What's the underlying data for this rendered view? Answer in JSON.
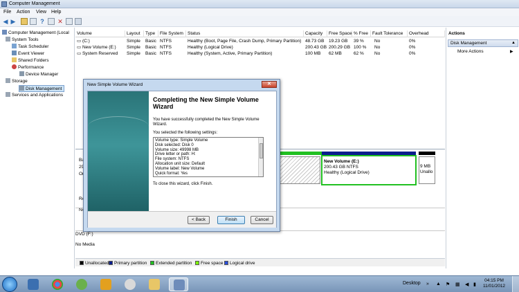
{
  "window": {
    "title": "Computer Management"
  },
  "menu": [
    "File",
    "Action",
    "View",
    "Help"
  ],
  "tree": {
    "root": "Computer Management (Local",
    "items": [
      {
        "label": "System Tools",
        "level": 1
      },
      {
        "label": "Task Scheduler",
        "level": 2
      },
      {
        "label": "Event Viewer",
        "level": 2
      },
      {
        "label": "Shared Folders",
        "level": 2
      },
      {
        "label": "Performance",
        "level": 2
      },
      {
        "label": "Device Manager",
        "level": 2
      },
      {
        "label": "Storage",
        "level": 1
      },
      {
        "label": "Disk Management",
        "level": 2,
        "selected": true
      },
      {
        "label": "Services and Applications",
        "level": 1
      }
    ]
  },
  "volumes": {
    "columns": [
      "Volume",
      "Layout",
      "Type",
      "File System",
      "Status",
      "Capacity",
      "Free Space",
      "% Free",
      "Fault Tolerance",
      "Overhead"
    ],
    "rows": [
      [
        "(C:)",
        "Simple",
        "Basic",
        "NTFS",
        "Healthy (Boot, Page File, Crash Dump, Primary Partition)",
        "48.73 GB",
        "19.23 GB",
        "39 %",
        "No",
        "0%"
      ],
      [
        "New Volume (E:)",
        "Simple",
        "Basic",
        "NTFS",
        "Healthy (Logical Drive)",
        "200.43 GB",
        "200.29 GB",
        "100 %",
        "No",
        "0%"
      ],
      [
        "System Reserved",
        "Simple",
        "Basic",
        "NTFS",
        "Healthy (System, Active, Primary Partition)",
        "100 MB",
        "62 MB",
        "62 %",
        "No",
        "0%"
      ]
    ]
  },
  "diskmap": {
    "left_labels": [
      "Ba",
      "29",
      "On",
      "Re",
      "No"
    ],
    "new_volume": {
      "name": "New Volume  (E:)",
      "size": "200.43 GB NTFS",
      "status": "Healthy (Logical Drive)"
    },
    "last_part": {
      "size": "9 MB",
      "status": "Unallo"
    },
    "cdrom": {
      "name": "DVD (F:)",
      "media": "No Media"
    }
  },
  "legend": [
    {
      "label": "Unallocated",
      "color": "#000000"
    },
    {
      "label": "Primary partition",
      "color": "#0a1d8c"
    },
    {
      "label": "Extended partition",
      "color": "#21c021"
    },
    {
      "label": "Free space",
      "color": "#7cfc00"
    },
    {
      "label": "Logical drive",
      "color": "#2b4fd8"
    }
  ],
  "actions": {
    "header": "Actions",
    "section": "Disk Management",
    "more": "More Actions"
  },
  "wizard": {
    "title": "New Simple Volume Wizard",
    "heading": "Completing the New Simple Volume Wizard",
    "intro": "You have successfully completed the New Simple Volume Wizard.",
    "selected_label": "You selected the following settings:",
    "summary": [
      "Volume type: Simple Volume",
      "Disk selected: Disk 0",
      "Volume size: 49998 MB",
      "Drive letter or path: H:",
      "File system: NTFS",
      "Allocation unit size: Default",
      "Volume label: New Volume",
      "Quick format: Yes"
    ],
    "close_text": "To close this wizard, click Finish.",
    "back": "< Back",
    "finish": "Finish",
    "cancel": "Cancel"
  },
  "taskbar": {
    "desktop": "Desktop",
    "time": "04:15 PM",
    "date": "11/01/2012"
  }
}
